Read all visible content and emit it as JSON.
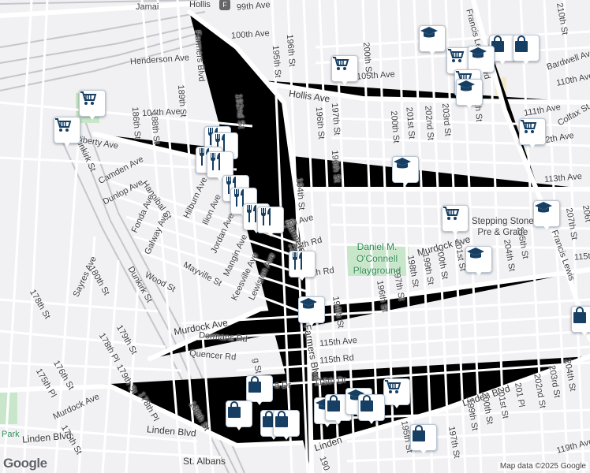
{
  "labels": {
    "jamaica": "Jamai",
    "hollis": "Hollis",
    "ave_99th": "99th Ave",
    "ave_100th": "100th Ave",
    "henderson": "Henderson Ave",
    "farmers_blvd_top": "Farmers Blvd",
    "ave_104th": "104th Ave",
    "liberty": "Liberty Ave",
    "st_186": "186th St",
    "st_188": "188th St",
    "st_189": "189th St",
    "st_192": "192nd St",
    "st_195": "195th St",
    "st_196a": "196th St",
    "st_196b": "196th St",
    "st_196c": "196th St",
    "st_197": "197th St",
    "st_200a": "200th St",
    "st_200b": "200th St",
    "ave_105th": "105th Ave",
    "hollis_ave": "Hollis Ave",
    "st_201": "201st St",
    "st_202": "202nd St",
    "st_203": "203rd St",
    "st_204": "204th St",
    "francis_top": "Francis Lewis Blvd",
    "bardwell": "Bardwell Ave",
    "ave_110th": "110th Ave",
    "ave_111th": "111th Ave",
    "colfax": "Colfax St",
    "ave_112th": "112th Ave",
    "ave_113th": "113th Ave",
    "st_210": "210th St",
    "camden": "Camden Ave",
    "dunlop": "Dunlop Ave",
    "hannibal": "Hannibal St",
    "hilburn": "Hilburn Ave",
    "ilion": "Ilion Ave",
    "fonda": "Fonda Ave",
    "galway": "Galway Ave",
    "jordan": "Jordan Ave",
    "mangin": "Mangin Ave",
    "keesville": "Keesville Ave",
    "mayville": "Mayville St",
    "wood": "Wood St",
    "lewiston": "Lewiston Ave",
    "st_194": "194th St",
    "ave_112_mid": "112th Ave",
    "rd_112": "112th Rd",
    "rd_113": "113th Rd",
    "farmers_mid": "Farmers Blvd",
    "dunkirk_a": "Dunkirk St",
    "dunkirk_b": "Dunkirk St",
    "st_180": "180th St",
    "st_178": "178th St",
    "st_179": "179th St",
    "pl_178": "178th Pl",
    "sayres": "Sayres Ave",
    "st_176": "176th St",
    "st_175": "175th St",
    "pl_175": "175th Pl",
    "murdock_left": "Murdock Ave",
    "murdock_main": "Murdock Ave",
    "murdock_right": "Murdock Ave",
    "dormans": "Dormans Rd",
    "quencer": "Quencer Rd",
    "ave_115th": "115th Ave",
    "rd_115th": "115th Rd",
    "dr_115th": "115th Dr",
    "st_194b": "194th St",
    "st_196d": "196th St",
    "st_197b": "197th St",
    "st_198": "198th St",
    "st_199": "199th St",
    "st_200c": "200th St",
    "st_201b": "201st St",
    "st_204b": "204th St",
    "st_205": "205th St",
    "francis_bottom": "Francis Lewis",
    "st_206": "206t",
    "st_207": "207th St",
    "ave_115_right": "115t",
    "linden_left": "Linden Blvd",
    "linden_mid": "Linden Blvd",
    "linden_right": "Linden Blvd",
    "st_180b": "180th St",
    "st_178b": "178th Pl",
    "st_179b": "179th St",
    "st_195b": "195th St",
    "st_197c": "197th St",
    "st_199b": "199th St",
    "st_200d": "200th St",
    "st_201c": "201st St",
    "pl_201": "201 Pl",
    "st_202b": "202nd St",
    "st_203b": "203rd St",
    "st_204c": "204th St",
    "ave_119th": "119th Ave",
    "st_albans": "St. Albans",
    "linden_bottom": "Linden",
    "park_left": "Park",
    "st_190": "190",
    "dr_mid": "a Dr",
    "st_g": "g St",
    "pl_t": "T"
  },
  "parks": {
    "oconnell": "Daniel M.\nO'Connell\nPlayground"
  },
  "places": {
    "stepping_stone": "Stepping Stone\nPre & Grade"
  },
  "subway": {
    "line": "F"
  },
  "branding": {
    "logo": "Google",
    "attribution": "Map data ©2025 Google"
  },
  "colors": {
    "marker_icon": "#163f63",
    "park": "#c8e6c9",
    "water": "#a8d7f0",
    "street": "#ffffff",
    "rail": "#c5c5cb"
  },
  "markers": [
    {
      "type": "cart"
    },
    {
      "type": "cart"
    },
    {
      "type": "cart"
    },
    {
      "type": "school"
    },
    {
      "type": "cart"
    },
    {
      "type": "bag"
    },
    {
      "type": "school"
    },
    {
      "type": "bag"
    },
    {
      "type": "cart"
    },
    {
      "type": "school"
    },
    {
      "type": "cart"
    },
    {
      "type": "school"
    },
    {
      "type": "cart"
    },
    {
      "type": "school"
    },
    {
      "type": "school"
    },
    {
      "type": "fork"
    },
    {
      "type": "fork"
    },
    {
      "type": "fork"
    },
    {
      "type": "fork"
    },
    {
      "type": "fork"
    },
    {
      "type": "fork"
    },
    {
      "type": "fork"
    },
    {
      "type": "fork"
    },
    {
      "type": "fork"
    },
    {
      "type": "school"
    },
    {
      "type": "bag"
    },
    {
      "type": "bag"
    },
    {
      "type": "bag"
    },
    {
      "type": "bag"
    },
    {
      "type": "school"
    },
    {
      "type": "bag"
    },
    {
      "type": "school"
    },
    {
      "type": "cart"
    },
    {
      "type": "bag"
    },
    {
      "type": "bag"
    },
    {
      "type": "bag"
    }
  ]
}
